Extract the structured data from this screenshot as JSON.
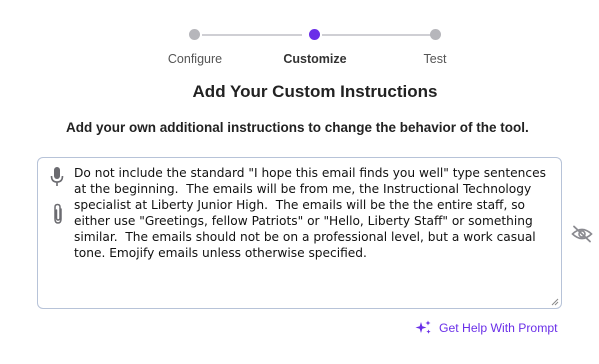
{
  "stepper": {
    "steps": [
      {
        "label": "Configure",
        "state": "complete"
      },
      {
        "label": "Customize",
        "state": "current"
      },
      {
        "label": "Test",
        "state": "upcoming"
      }
    ],
    "active_color": "#6a2fe8",
    "inactive_color": "#b6b6bb"
  },
  "heading": "Add Your Custom Instructions",
  "subheading": "Add your own additional instructions to change the behavior of the tool.",
  "instructions": {
    "value": "Do not include the standard \"I hope this email finds you well\" type sentences at the beginning.  The emails will be from me, the Instructional Technology specialist at Liberty Junior High.  The emails will be the the entire staff, so either use \"Greetings, fellow Patriots\" or \"Hello, Liberty Staff\" or something similar.  The emails should not be on a professional level, but a work casual tone. Emojify emails unless otherwise specified."
  },
  "icons": {
    "microphone": "microphone-icon",
    "attach": "paperclip-icon",
    "visibility": "eye-off-icon",
    "help": "sparkle-icon"
  },
  "help_link": {
    "label": "Get Help With Prompt",
    "color": "#6a2fe8"
  }
}
